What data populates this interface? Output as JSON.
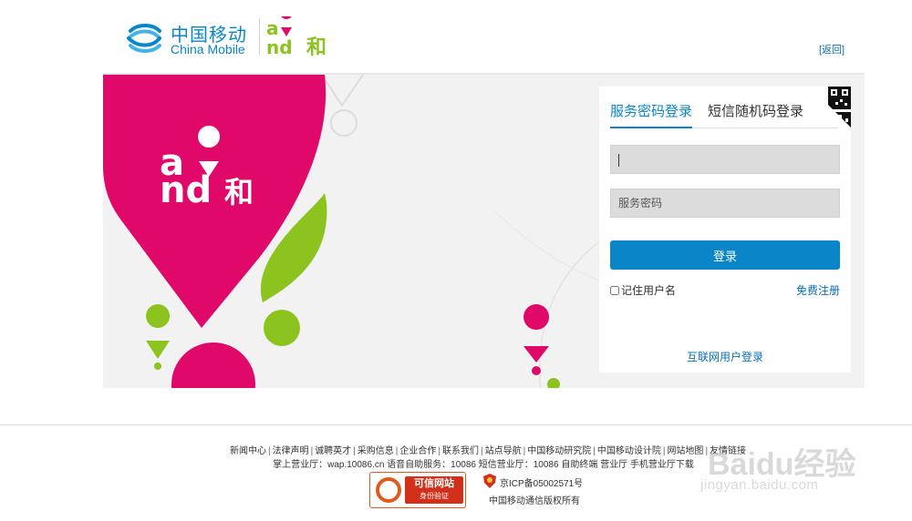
{
  "header": {
    "brand_cn": "中国移动",
    "brand_en": "China Mobile",
    "sub_brand": "and和",
    "back_link": "[返回]"
  },
  "banner": {
    "logo_text": "and和",
    "colors": {
      "magenta": "#e0096a",
      "green": "#8cc31f",
      "background": "#f2f2f2"
    }
  },
  "login": {
    "tabs": [
      {
        "label": "服务密码登录",
        "active": true
      },
      {
        "label": "短信随机码登录",
        "active": false
      }
    ],
    "username_value": "",
    "password_placeholder": "服务密码",
    "submit_label": "登录",
    "remember_label": "记住用户名",
    "register_label": "免费注册",
    "internet_login_label": "互联网用户登录",
    "accent_color": "#0a86c8"
  },
  "footer": {
    "links": [
      "新闻中心",
      "法律声明",
      "诚聘英才",
      "采购信息",
      "企业合作",
      "联系我们",
      "站点导航",
      "中国移动研究院",
      "中国移动设计院",
      "网站地图",
      "友情链接"
    ],
    "services": "掌上营业厅：wap.10086.cn 语音自助服务：10086 短信营业厅：10086 自助终端 营业厅 手机营业厅下载",
    "trust_badge_title": "可信网站",
    "trust_badge_sub": "身份验证",
    "icp": "京ICP备05002571号",
    "copyright": "中国移动通信版权所有"
  },
  "watermark": {
    "main": "Baidu经验",
    "sub": "jingyan.baidu.com"
  }
}
